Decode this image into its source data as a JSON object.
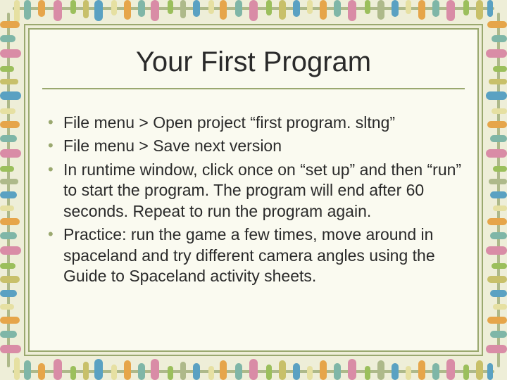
{
  "title": "Your First Program",
  "bullets": [
    "File menu > Open project “first program. sltng”",
    "File menu > Save next version",
    "In runtime window, click once on “set up” and then “run” to start the program. The program will end after 60 seconds. Repeat to run the program again.",
    "Practice: run the game a few times, move around in spaceland and try different camera angles using the Guide to Spaceland activity sheets."
  ]
}
